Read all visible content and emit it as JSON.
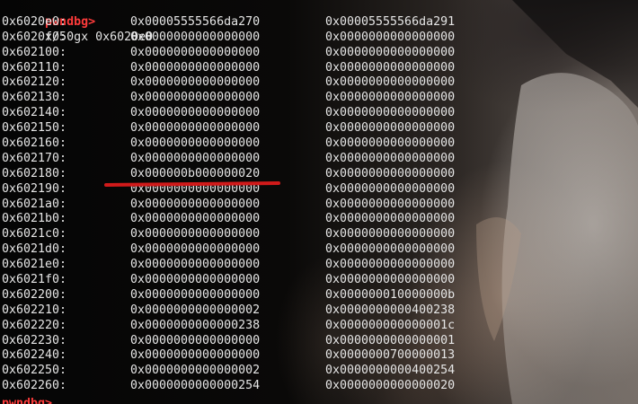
{
  "prompt": {
    "label": "pwndbg>",
    "command": "x/50gx 0x6020e0"
  },
  "rows": [
    {
      "addr": "0x6020e0:",
      "v1": "0x00005555566da270",
      "v2": "0x00005555566da291"
    },
    {
      "addr": "0x6020f0:",
      "v1": "0x0000000000000000",
      "v2": "0x0000000000000000"
    },
    {
      "addr": "0x602100:",
      "v1": "0x0000000000000000",
      "v2": "0x0000000000000000"
    },
    {
      "addr": "0x602110:",
      "v1": "0x0000000000000000",
      "v2": "0x0000000000000000"
    },
    {
      "addr": "0x602120:",
      "v1": "0x0000000000000000",
      "v2": "0x0000000000000000"
    },
    {
      "addr": "0x602130:",
      "v1": "0x0000000000000000",
      "v2": "0x0000000000000000"
    },
    {
      "addr": "0x602140:",
      "v1": "0x0000000000000000",
      "v2": "0x0000000000000000"
    },
    {
      "addr": "0x602150:",
      "v1": "0x0000000000000000",
      "v2": "0x0000000000000000"
    },
    {
      "addr": "0x602160:",
      "v1": "0x0000000000000000",
      "v2": "0x0000000000000000"
    },
    {
      "addr": "0x602170:",
      "v1": "0x0000000000000000",
      "v2": "0x0000000000000000"
    },
    {
      "addr": "0x602180:",
      "v1": "0x000000b000000020",
      "v2": "0x0000000000000000"
    },
    {
      "addr": "0x602190:",
      "v1": "0x0000000000000000",
      "v2": "0x0000000000000000"
    },
    {
      "addr": "0x6021a0:",
      "v1": "0x0000000000000000",
      "v2": "0x0000000000000000"
    },
    {
      "addr": "0x6021b0:",
      "v1": "0x0000000000000000",
      "v2": "0x0000000000000000"
    },
    {
      "addr": "0x6021c0:",
      "v1": "0x0000000000000000",
      "v2": "0x0000000000000000"
    },
    {
      "addr": "0x6021d0:",
      "v1": "0x0000000000000000",
      "v2": "0x0000000000000000"
    },
    {
      "addr": "0x6021e0:",
      "v1": "0x0000000000000000",
      "v2": "0x0000000000000000"
    },
    {
      "addr": "0x6021f0:",
      "v1": "0x0000000000000000",
      "v2": "0x0000000000000000"
    },
    {
      "addr": "0x602200:",
      "v1": "0x0000000000000000",
      "v2": "0x000000010000000b"
    },
    {
      "addr": "0x602210:",
      "v1": "0x0000000000000002",
      "v2": "0x0000000000400238"
    },
    {
      "addr": "0x602220:",
      "v1": "0x0000000000000238",
      "v2": "0x000000000000001c"
    },
    {
      "addr": "0x602230:",
      "v1": "0x0000000000000000",
      "v2": "0x0000000000000001"
    },
    {
      "addr": "0x602240:",
      "v1": "0x0000000000000000",
      "v2": "0x0000000700000013"
    },
    {
      "addr": "0x602250:",
      "v1": "0x0000000000000002",
      "v2": "0x0000000000400254"
    },
    {
      "addr": "0x602260:",
      "v1": "0x0000000000000254",
      "v2": "0x0000000000000020"
    }
  ],
  "next_prompt_partial": "pwndbg>",
  "colors": {
    "prompt": "#ff3b3b",
    "text": "#e6e6e6",
    "underline": "#d11a1a"
  }
}
